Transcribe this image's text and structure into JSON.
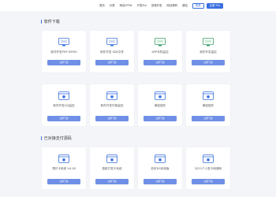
{
  "nav": {
    "items": [
      "首页",
      "分类",
      "网站HTML",
      "开发Pro",
      "前端开发",
      "网站源码",
      "建站"
    ],
    "login": "登录",
    "register": "注册 Pro"
  },
  "sections": [
    {
      "title": "软件下载",
      "cards": [
        {
          "name": "软件开发PHP DEMO",
          "desc": "",
          "button": "立即下载"
        },
        {
          "name": "软件开发 SDK文件",
          "desc": "",
          "button": "立即下载"
        },
        {
          "name": "APP手机监控",
          "desc": "",
          "button": "立即下载"
        },
        {
          "name": "软件开发监控",
          "desc": "",
          "button": "立即下载"
        },
        {
          "name": "软件开发QQ监控",
          "desc": "",
          "button": "立即下载"
        },
        {
          "name": "软件开发付款监控",
          "desc": "",
          "button": "立即下载"
        },
        {
          "name": "微信插件",
          "desc": "",
          "button": "立即下载"
        },
        {
          "name": "微信插件",
          "desc": "",
          "button": "立即下载"
        }
      ]
    },
    {
      "title": "已对接支付源码",
      "cards": [
        {
          "name": "预付卡系统 V4.28",
          "desc": "",
          "button": "立即下载"
        },
        {
          "name": "易航打发卡系统",
          "desc": "",
          "button": "立即下载"
        },
        {
          "name": "彩虹DS系统版",
          "desc": "",
          "button": "立即下载"
        },
        {
          "name": "2021个人发卡网源码",
          "desc": "",
          "button": "立即下载"
        }
      ]
    }
  ],
  "colors": {
    "accent": "#3a6fe0",
    "button": "#6f90e6",
    "background": "#f4f5f9"
  }
}
